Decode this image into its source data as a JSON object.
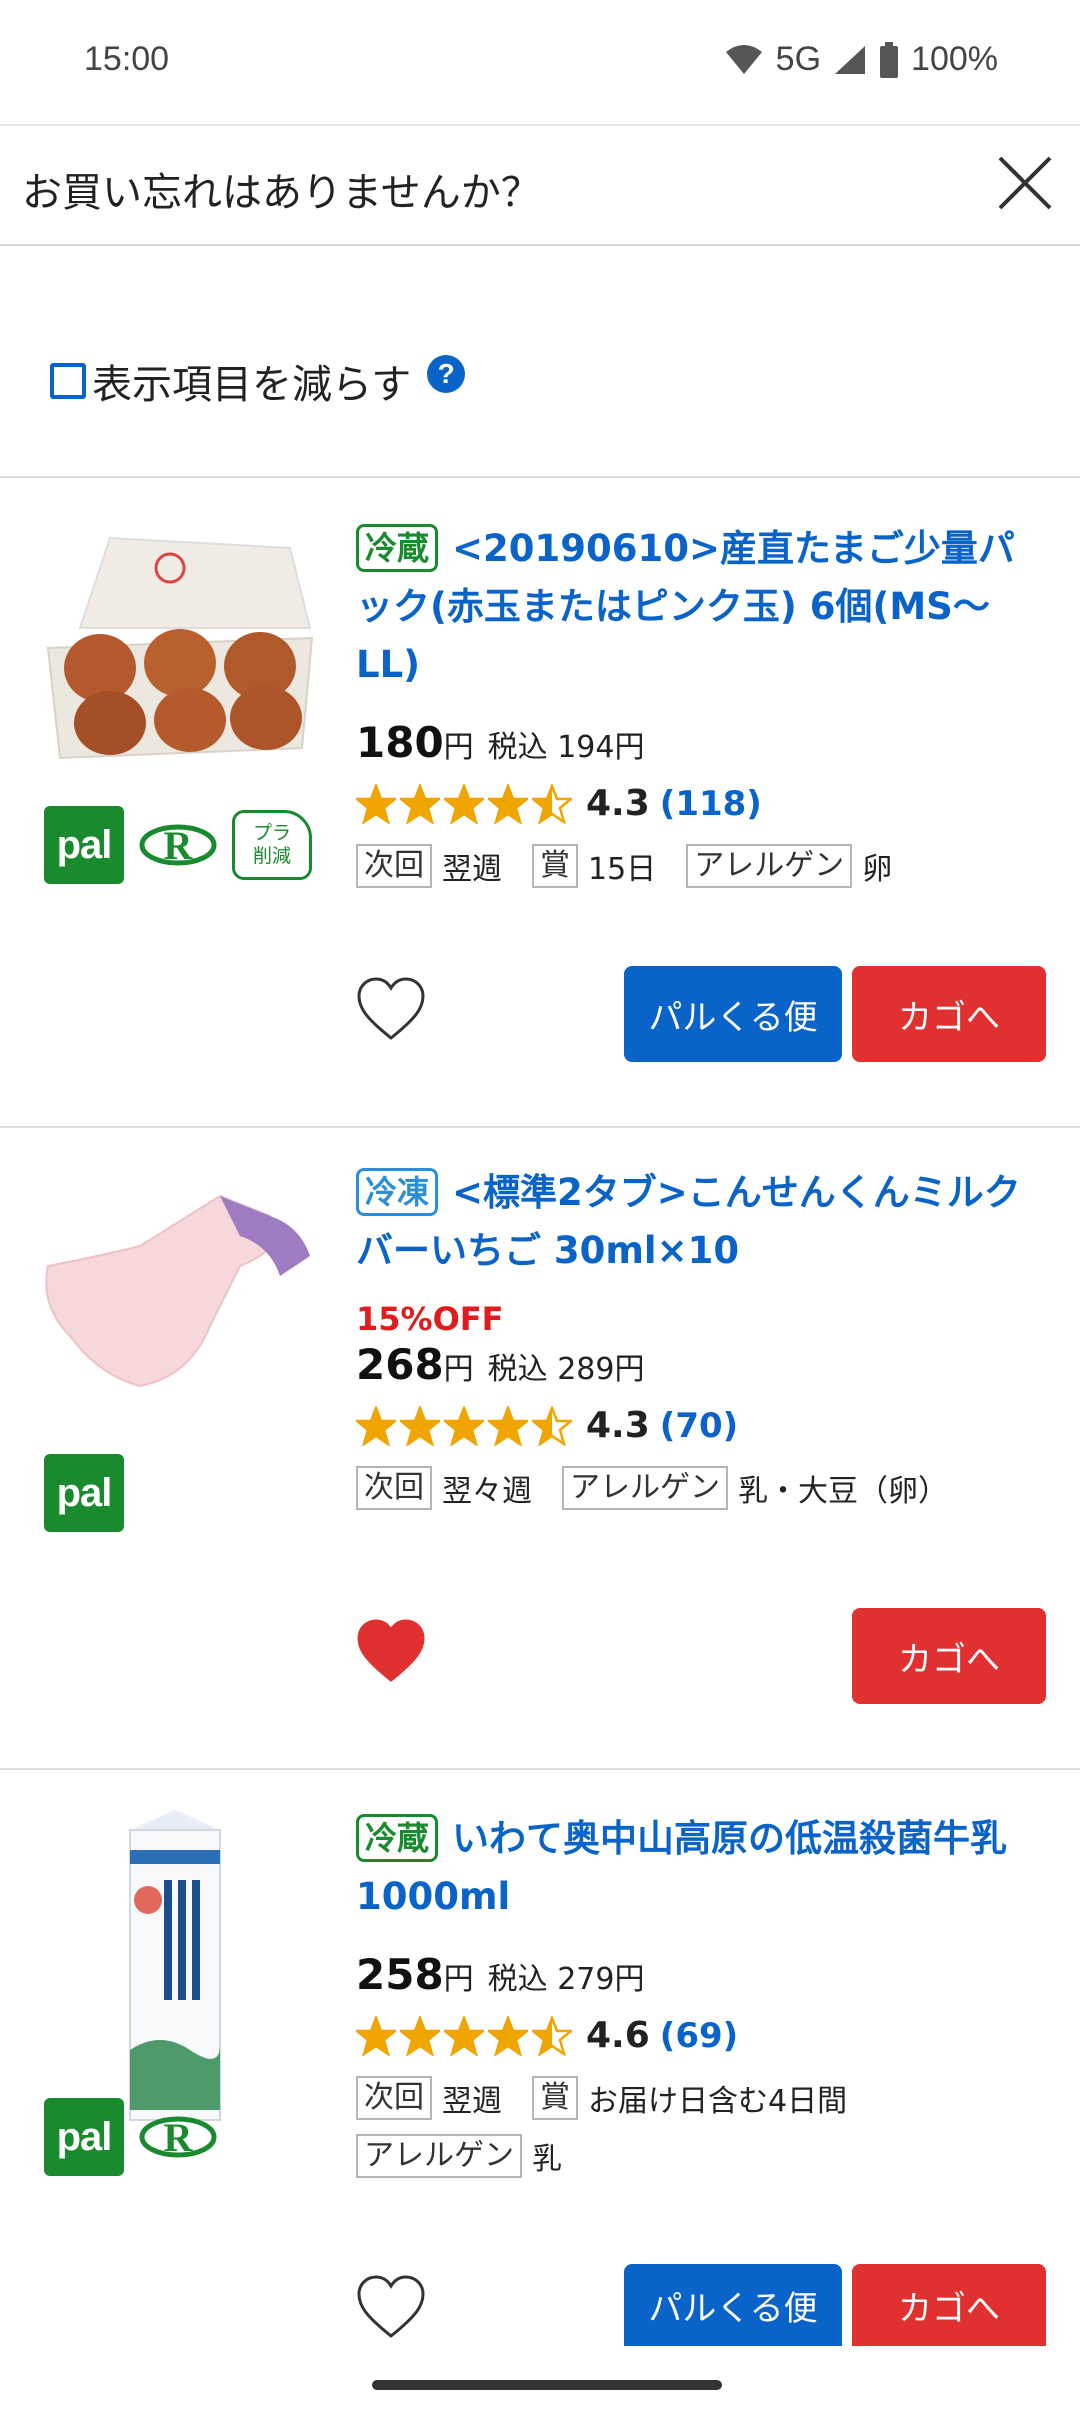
{
  "status": {
    "time": "15:00",
    "network": "5G",
    "battery": "100%"
  },
  "dialog": {
    "title": "お買い忘れはありませんか？",
    "close_icon": "close-icon"
  },
  "options": {
    "reduce_label": "表示項目を減らす",
    "help": "?"
  },
  "products": [
    {
      "temp": "冷蔵",
      "title": "<20190610>産直たまご少量パック(赤玉またはピンク玉) 6個(MS〜LL)",
      "discount": "",
      "price": "180",
      "yen": "円",
      "tax": "税込 194円",
      "rating": "4.3",
      "rating_count": "(118)",
      "rating_value": 4.3,
      "meta": [
        {
          "label": "次回",
          "value": "翌週"
        },
        {
          "label": "賞",
          "value": "15日"
        },
        {
          "label": "アレルゲン",
          "value": "卵"
        }
      ],
      "badges": [
        "pal",
        "R",
        "プラ削減"
      ],
      "pla_line1": "プラ",
      "pla_line2": "削減",
      "pal_label": "pal",
      "favorite": false,
      "pal_button": "パルくる便",
      "cart_button": "カゴへ"
    },
    {
      "temp": "冷凍",
      "title": "<標準2タブ>こんせんくんミルクバーいちご 30ml×10",
      "discount": "15%OFF",
      "price": "268",
      "yen": "円",
      "tax": "税込 289円",
      "rating": "4.3",
      "rating_count": "(70)",
      "rating_value": 4.3,
      "meta": [
        {
          "label": "次回",
          "value": "翌々週"
        },
        {
          "label": "アレルゲン",
          "value": "乳・大豆（卵）"
        }
      ],
      "badges": [
        "pal"
      ],
      "pal_label": "pal",
      "favorite": true,
      "cart_button": "カゴへ"
    },
    {
      "temp": "冷蔵",
      "title": "いわて奥中山高原の低温殺菌牛乳 1000ml",
      "discount": "",
      "price": "258",
      "yen": "円",
      "tax": "税込 279円",
      "rating": "4.6",
      "rating_count": "(69)",
      "rating_value": 4.6,
      "meta": [
        {
          "label": "次回",
          "value": "翌週"
        },
        {
          "label": "賞",
          "value": "お届け日含む4日間"
        },
        {
          "label": "アレルゲン",
          "value": "乳"
        }
      ],
      "badges": [
        "pal",
        "R"
      ],
      "pal_label": "pal",
      "favorite": false,
      "pal_button": "パルくる便",
      "cart_button": "カゴへ"
    }
  ],
  "colors": {
    "accent_blue": "#0a63c9",
    "cart_red": "#e0302f",
    "pal_green": "#198a2e",
    "star": "#f0a500"
  }
}
